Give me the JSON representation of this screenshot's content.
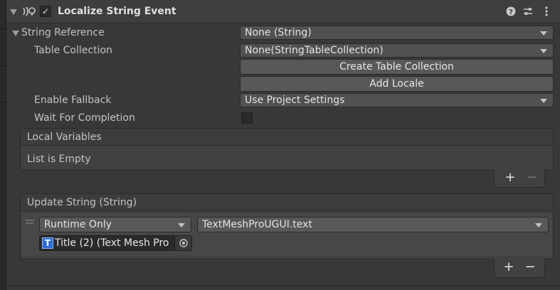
{
  "component": {
    "title": "Localize String Event",
    "enabled": true
  },
  "string_reference": {
    "label": "String Reference",
    "value": "None (String)"
  },
  "table_collection": {
    "label": "Table Collection",
    "value": "None(StringTableCollection)"
  },
  "buttons": {
    "create_table_collection": "Create Table Collection",
    "add_locale": "Add Locale"
  },
  "enable_fallback": {
    "label": "Enable Fallback",
    "value": "Use Project Settings"
  },
  "wait_for_completion": {
    "label": "Wait For Completion",
    "checked": false
  },
  "local_variables": {
    "header": "Local Variables",
    "empty_text": "List is Empty",
    "add": "+",
    "remove": "−"
  },
  "update_string": {
    "header": "Update String (String)",
    "runtime": "Runtime Only",
    "function": "TextMeshProUGUI.text",
    "target_object": "Title (2) (Text Mesh Pro",
    "add": "+",
    "remove": "−"
  },
  "icons": [
    "foldout-arrow-icon",
    "localization-icon",
    "checkbox-icon",
    "help-icon",
    "preset-icon",
    "more-icon",
    "text-mesh-pro-icon",
    "object-picker-icon"
  ]
}
